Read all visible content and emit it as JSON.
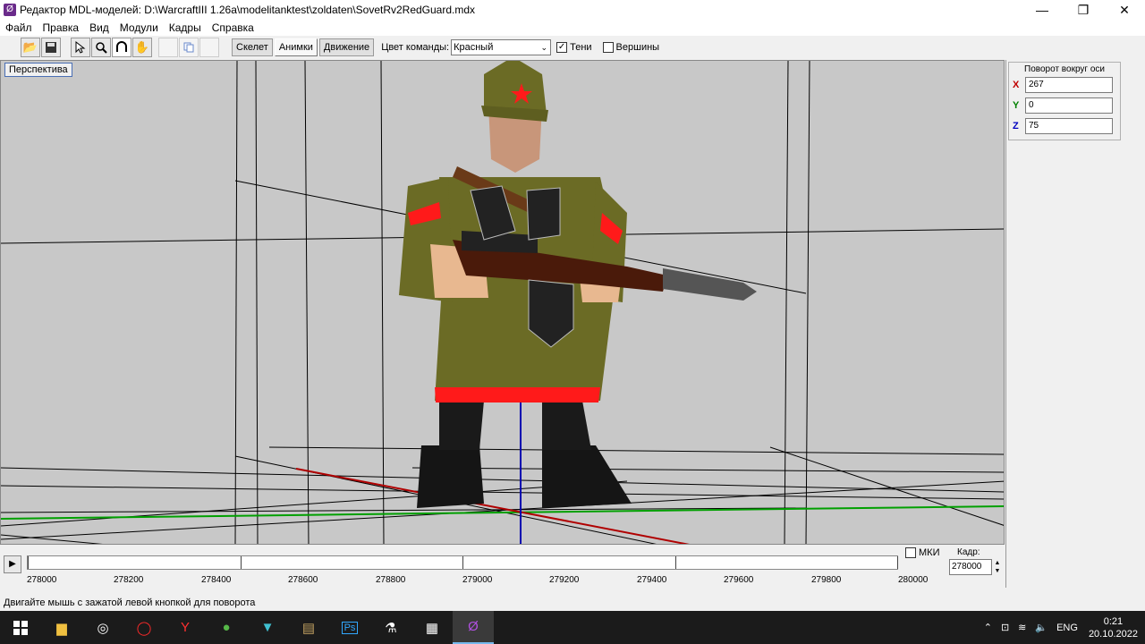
{
  "window": {
    "title": "Редактор MDL-моделей: D:\\WarcraftIII 1.26a\\modelitanktest\\zoldaten\\SovetRv2RedGuard.mdx",
    "app_icon": "warcraft-mdl-icon",
    "minimize": "—",
    "maximize": "❐",
    "close": "✕"
  },
  "menu": {
    "items": [
      "Файл",
      "Правка",
      "Вид",
      "Модули",
      "Кадры",
      "Справка"
    ]
  },
  "toolbar": {
    "tabs": [
      "Скелет",
      "Анимки",
      "Движение"
    ],
    "active_tab": "Анимки",
    "team_color_label": "Цвет команды:",
    "team_color_value": "Красный",
    "shadows_label": "Тени",
    "shadows_checked": true,
    "vertices_label": "Вершины",
    "vertices_checked": false
  },
  "viewport": {
    "view_button": "Перспектива"
  },
  "rotation_panel": {
    "header": "Поворот вокруг оси",
    "x_label": "X",
    "x_value": "267",
    "y_label": "Y",
    "y_value": "0",
    "z_label": "Z",
    "z_value": "75",
    "colors": {
      "x": "#c00000",
      "y": "#008000",
      "z": "#0000c0"
    }
  },
  "timeline": {
    "ticks": [
      "278000",
      "278200",
      "278400",
      "278600",
      "278800",
      "279000",
      "279200",
      "279400",
      "279600",
      "279800",
      "280000"
    ],
    "mki_label": "МКИ",
    "mki_checked": false,
    "frame_label": "Кадр:",
    "frame_value": "278000"
  },
  "statusbar": {
    "text": "Двигайте мышь с зажатой левой кнопкой для поворота"
  },
  "taskbar": {
    "tray_lang": "ENG",
    "time": "0:21",
    "date": "20.10.2022"
  }
}
